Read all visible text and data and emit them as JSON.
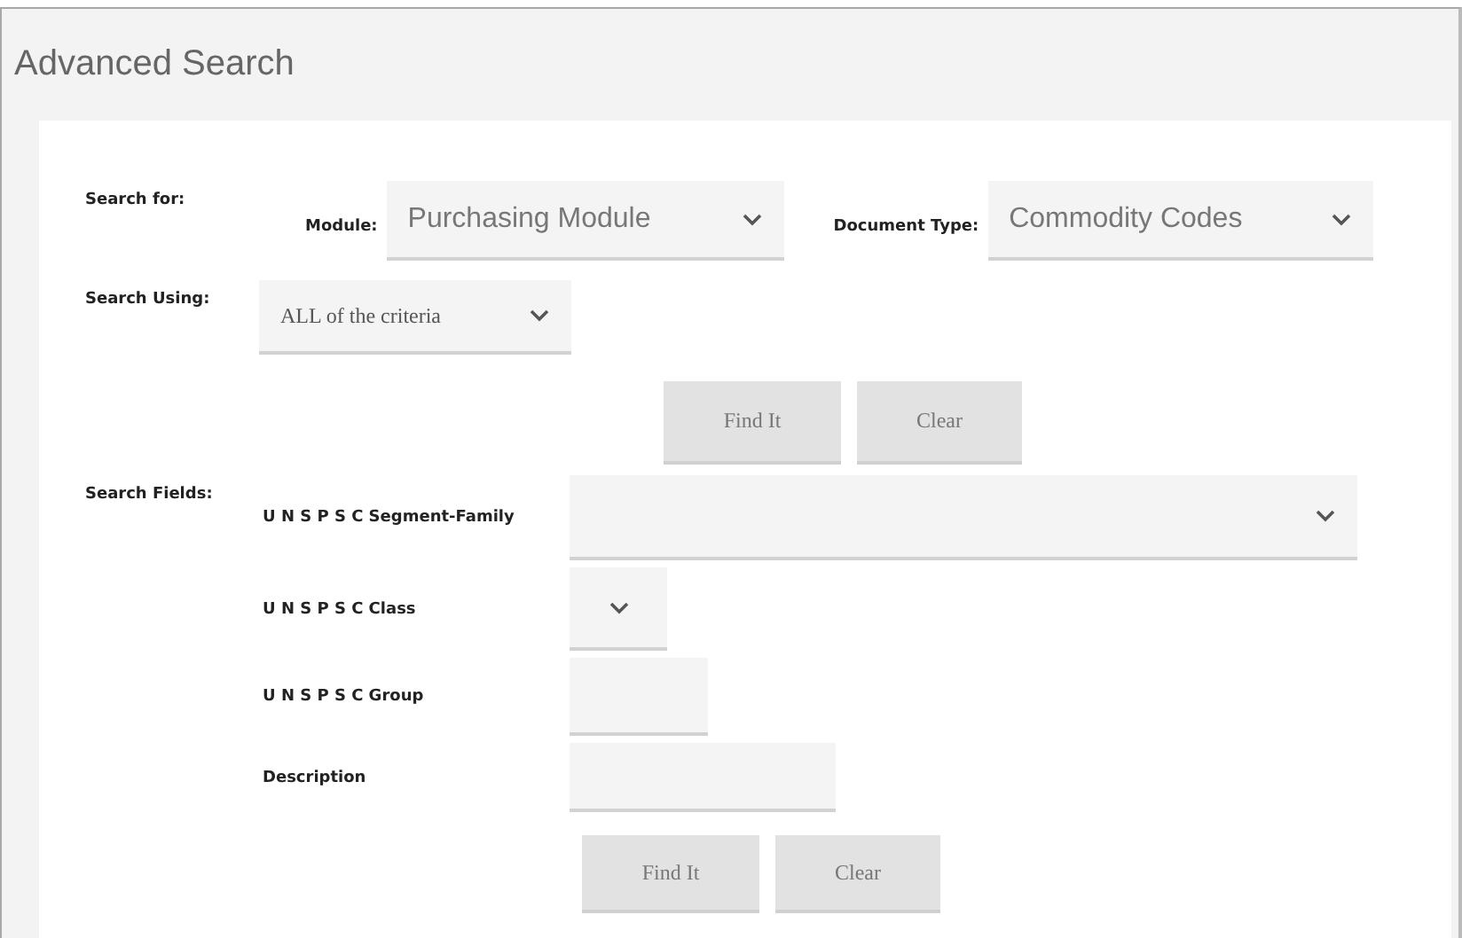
{
  "title": "Advanced Search",
  "search_for": {
    "label": "Search for:",
    "selects": [
      {
        "label": "Module:",
        "value": "Purchasing Module"
      },
      {
        "label": "Document Type:",
        "value": "Commodity Codes"
      }
    ]
  },
  "search_using": {
    "label": "Search Using:",
    "value": "ALL of the criteria"
  },
  "top_buttons": [
    "Find It",
    "Clear"
  ],
  "search_fields": {
    "label": "Search Fields:",
    "fields": [
      {
        "label": "U N S P S C Segment-Family",
        "kind": "select"
      },
      {
        "label": "U N S P S C Class",
        "kind": "select"
      },
      {
        "label": "U N S P S C Group",
        "kind": "text"
      },
      {
        "label": "Description",
        "kind": "text"
      }
    ]
  },
  "bottom_buttons": [
    "Find It",
    "Clear"
  ]
}
